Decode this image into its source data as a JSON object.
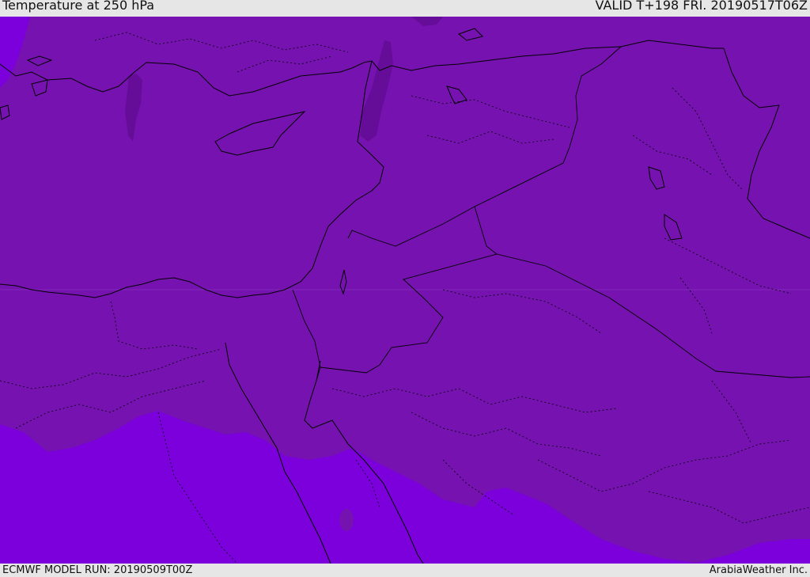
{
  "header": {
    "title": "Temperature at 250 hPa",
    "valid_time": "VALID T+198 FRI. 20190517T06Z"
  },
  "footer": {
    "model_run": "ECMWF MODEL RUN: 20190509T00Z",
    "credit": "ArabiaWeather Inc."
  },
  "colors": {
    "band_main": "#7612b0",
    "band_warm": "#7b00dc",
    "band_cold": "#650d99",
    "coastline": "#000000",
    "borders": "#000000"
  }
}
